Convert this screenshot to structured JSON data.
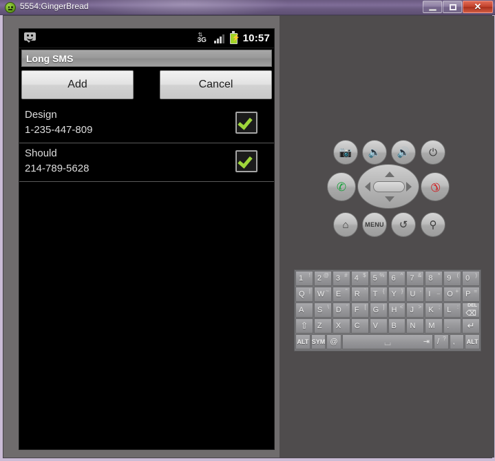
{
  "window": {
    "title": "5554:GingerBread",
    "icon": "android-icon",
    "controls": {
      "minimize": "minimize-button",
      "maximize": "maximize-button",
      "close_label": "✕"
    }
  },
  "device": {
    "statusbar": {
      "notification_icon": "sms-message-icon",
      "network": "3G",
      "network_arrows": "⇅",
      "signal_icon": "signal-bars-icon",
      "battery_icon": "battery-charging-icon",
      "clock": "10:57"
    },
    "app": {
      "title": "Long SMS",
      "buttons": {
        "add": "Add",
        "cancel": "Cancel"
      },
      "contacts": [
        {
          "name": "Design",
          "number": "1-235-447-809",
          "checked": true
        },
        {
          "name": "Should",
          "number": "214-789-5628",
          "checked": true
        }
      ]
    }
  },
  "panel": {
    "hardware_buttons": [
      {
        "name": "camera-button",
        "glyph": "■"
      },
      {
        "name": "volume-down-button",
        "glyph": "◂"
      },
      {
        "name": "volume-up-button",
        "glyph": "◂"
      },
      {
        "name": "power-button",
        "glyph": "⏻"
      },
      {
        "name": "call-button",
        "glyph": "☎"
      },
      {
        "name": "end-call-button",
        "glyph": "☎"
      },
      {
        "name": "home-button",
        "glyph": "⌂"
      },
      {
        "name": "menu-button",
        "glyph": "MENU"
      },
      {
        "name": "back-button",
        "glyph": "↶"
      },
      {
        "name": "search-button",
        "glyph": "⚲"
      }
    ],
    "dpad": {
      "up": "▲",
      "down": "▼",
      "left": "◀",
      "right": "▶",
      "ok": "OK"
    },
    "keyboard": {
      "row1": [
        {
          "main": "1",
          "sup": "!"
        },
        {
          "main": "2",
          "sup": "@"
        },
        {
          "main": "3",
          "sup": "#"
        },
        {
          "main": "4",
          "sup": "$"
        },
        {
          "main": "5",
          "sup": "%"
        },
        {
          "main": "6",
          "sup": "^"
        },
        {
          "main": "7",
          "sup": "&"
        },
        {
          "main": "8",
          "sup": "*"
        },
        {
          "main": "9",
          "sup": "("
        },
        {
          "main": "0",
          "sup": ")"
        }
      ],
      "row2": [
        {
          "main": "Q",
          "sup": "|"
        },
        {
          "main": "W",
          "sup": "~"
        },
        {
          "main": "E",
          "sup": "\""
        },
        {
          "main": "R",
          "sup": "`"
        },
        {
          "main": "T",
          "sup": "{"
        },
        {
          "main": "Y",
          "sup": "}"
        },
        {
          "main": "U",
          "sup": "-"
        },
        {
          "main": "I",
          "sup": "_"
        },
        {
          "main": "O",
          "sup": "+"
        },
        {
          "main": "P",
          "sup": "="
        }
      ],
      "row3": [
        {
          "main": "A",
          "sup": ""
        },
        {
          "main": "S",
          "sup": "\\"
        },
        {
          "main": "D",
          "sup": "'"
        },
        {
          "main": "F",
          "sup": "["
        },
        {
          "main": "G",
          "sup": "]"
        },
        {
          "main": "H",
          "sup": "<"
        },
        {
          "main": "J",
          "sup": ">"
        },
        {
          "main": "K",
          "sup": ";"
        },
        {
          "main": "L",
          "sup": ":"
        },
        {
          "main": "DEL",
          "sup": ""
        }
      ],
      "row4": [
        {
          "main": "⇧",
          "sup": ""
        },
        {
          "main": "Z",
          "sup": ""
        },
        {
          "main": "X",
          "sup": ""
        },
        {
          "main": "C",
          "sup": ""
        },
        {
          "main": "V",
          "sup": ""
        },
        {
          "main": "B",
          "sup": ""
        },
        {
          "main": "N",
          "sup": ""
        },
        {
          "main": "M",
          "sup": ""
        },
        {
          "main": ".",
          "sup": ""
        },
        {
          "main": "↵",
          "sup": ""
        }
      ],
      "row5": [
        {
          "main": "ALT",
          "sup": ""
        },
        {
          "main": "SYM",
          "sup": ""
        },
        {
          "main": "@",
          "sup": ""
        },
        {
          "main": "SPACE",
          "sup": "⇥"
        },
        {
          "main": "/",
          "sup": "?"
        },
        {
          "main": ",",
          "sup": ""
        },
        {
          "main": "ALT",
          "sup": ""
        }
      ],
      "del_label": "DEL",
      "del_glyph": "⌫"
    }
  }
}
